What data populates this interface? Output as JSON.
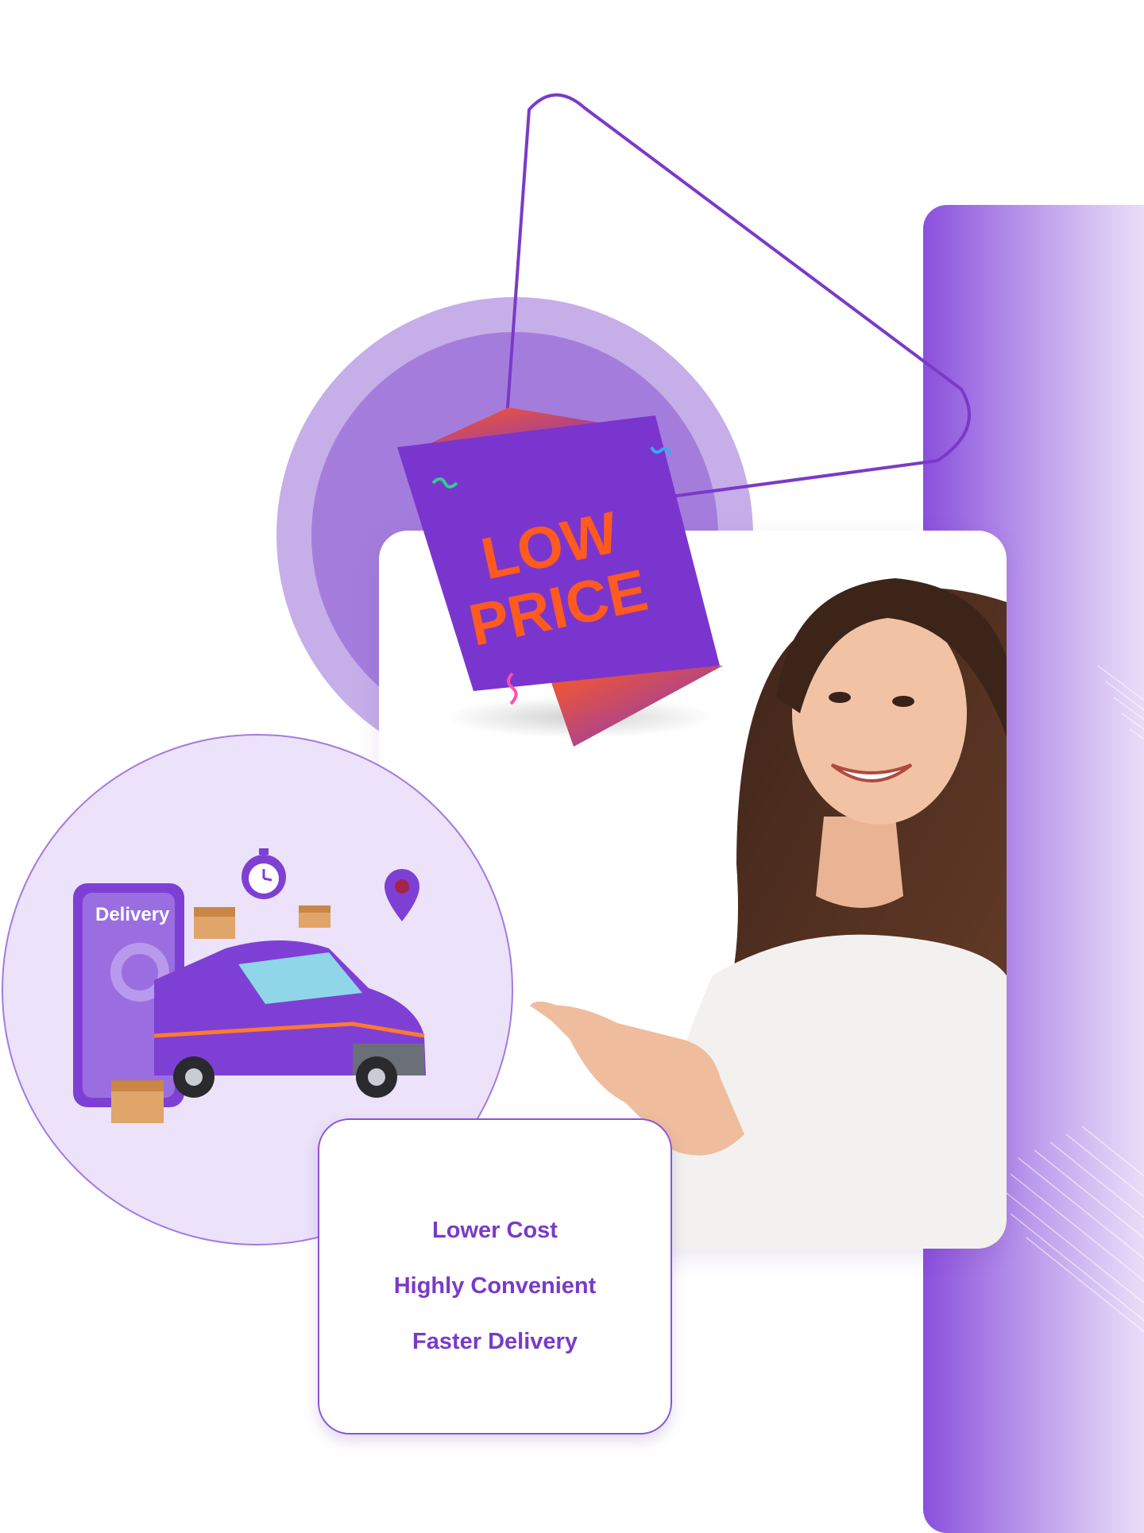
{
  "tag": {
    "line1": "LOW",
    "line2": "PRICE"
  },
  "delivery": {
    "phone_label": "Delivery"
  },
  "features": [
    {
      "label": "Lower Cost"
    },
    {
      "label": "Highly Convenient"
    },
    {
      "label": "Faster Delivery"
    }
  ],
  "colors": {
    "brand_purple": "#7a3ac8",
    "tag_purple": "#7b35cf",
    "tag_text_orange": "#ff5a1f",
    "panel_gradient_start": "#8a4fdc",
    "panel_gradient_end": "#efe6fb"
  },
  "icons": [
    "stopwatch-icon",
    "location-pin-icon",
    "package-icon"
  ]
}
